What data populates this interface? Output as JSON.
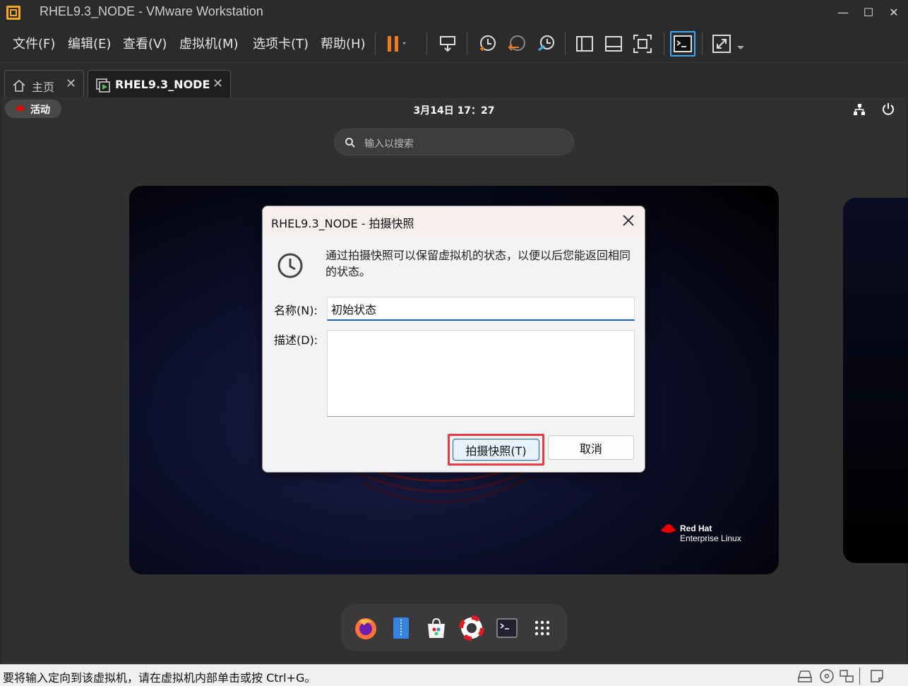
{
  "window": {
    "title": "RHEL9.3_NODE - VMware Workstation"
  },
  "menu": {
    "file": "文件(F)",
    "edit": "编辑(E)",
    "view": "查看(V)",
    "vm": "虚拟机(M)",
    "tabs": "选项卡(T)",
    "help": "帮助(H)"
  },
  "tabs": [
    {
      "label": "主页"
    },
    {
      "label": "RHEL9.3_NODE"
    }
  ],
  "gnome": {
    "activities": "活动",
    "clock": "3月14日 17：27",
    "search_placeholder": "输入以搜索",
    "brand_line1": "Red Hat",
    "brand_line2": "Enterprise Linux"
  },
  "dock": [
    "firefox-icon",
    "files-icon",
    "software-icon",
    "help-icon",
    "terminal-icon",
    "app-grid-icon"
  ],
  "dialog": {
    "title": "RHEL9.3_NODE - 拍摄快照",
    "description": "通过拍摄快照可以保留虚拟机的状态，以便以后您能返回相同的状态。",
    "name_label": "名称(N):",
    "name_value": "初始状态",
    "desc_label": "描述(D):",
    "desc_value": "",
    "snapshot_button": "拍摄快照(T)",
    "cancel_button": "取消"
  },
  "status": {
    "text": "要将输入定向到该虚拟机，请在虚拟机内部单击或按 Ctrl+G。"
  },
  "colors": {
    "accent": "#1a5fb4",
    "highlight": "#e83a45",
    "pause": "#f07b1d"
  }
}
